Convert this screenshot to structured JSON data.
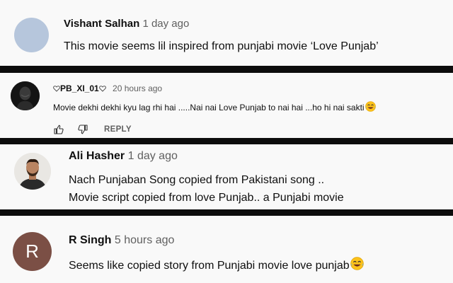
{
  "comments": [
    {
      "author": "Vishant Salhan",
      "time": "1 day ago",
      "text": "This movie seems lil inspired from punjabi movie ‘Love Punjab’",
      "avatar_color": "#b6c6dc"
    },
    {
      "author": "PB_XI_01",
      "time": "20 hours ago",
      "text": "Movie dekhi dekhi kyu lag rhi hai .....Nai nai Love Punjab to nai hai ...ho hi nai sakti",
      "reply_label": "REPLY",
      "avatar_color": "#151515"
    },
    {
      "author": "Ali Hasher",
      "time": "1 day ago",
      "text_line1": "Nach Punjaban Song copied from Pakistani song ..",
      "text_line2": "Movie script copied from love Punjab.. a Punjabi movie",
      "avatar_color": "#e9e7e3"
    },
    {
      "author": "R Singh",
      "time": "5 hours ago",
      "text": "Seems like copied story from Punjabi movie love punjab",
      "avatar_letter": "R",
      "avatar_color": "#7b4f45"
    }
  ],
  "icons": {
    "like": "thumbs-up-icon",
    "dislike": "thumbs-down-icon",
    "emoji": "laughing-tears-emoji",
    "heart": "heart-outline-icon"
  }
}
